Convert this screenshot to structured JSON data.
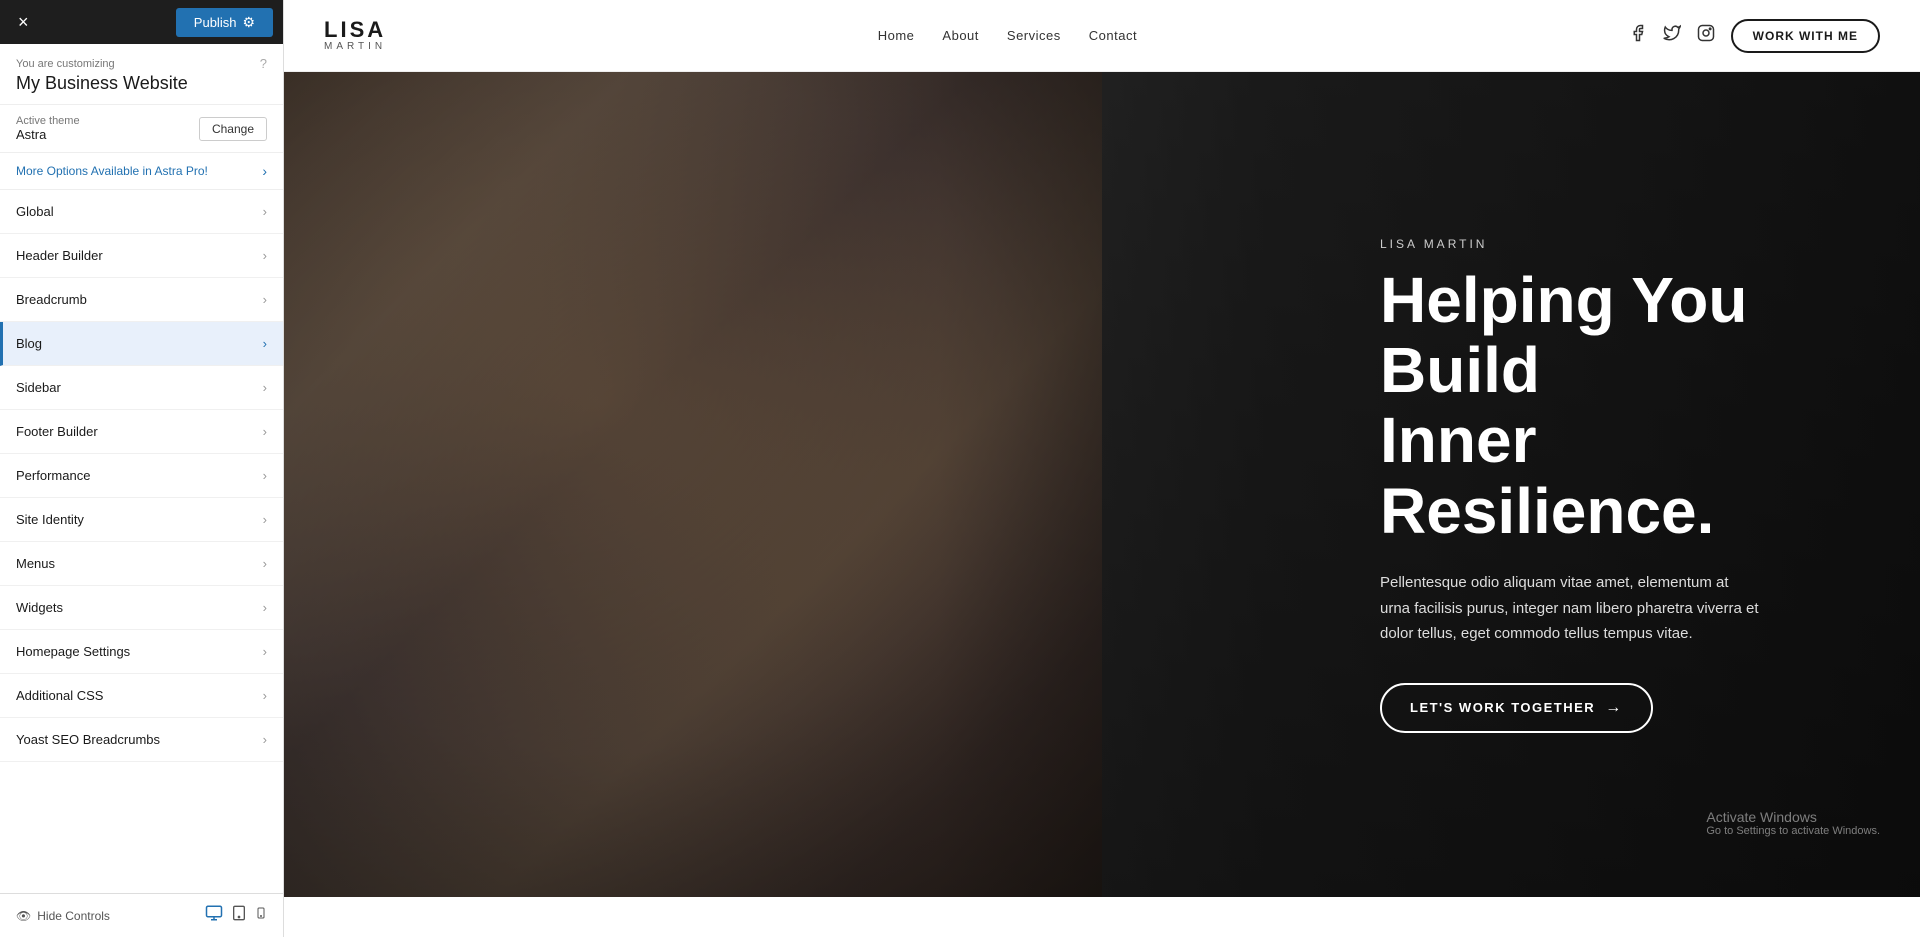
{
  "sidebar": {
    "topbar": {
      "close_label": "×",
      "publish_label": "Publish",
      "gear_icon": "⚙"
    },
    "customizing": {
      "label": "You are customizing",
      "help_icon": "?",
      "title": "My Business Website"
    },
    "active_theme": {
      "label": "Active theme",
      "name": "Astra",
      "change_label": "Change"
    },
    "astra_banner": {
      "text": "More Options Available in Astra Pro!"
    },
    "nav_items": [
      {
        "label": "Global",
        "active": false
      },
      {
        "label": "Header Builder",
        "active": false
      },
      {
        "label": "Breadcrumb",
        "active": false
      },
      {
        "label": "Blog",
        "active": true
      },
      {
        "label": "Sidebar",
        "active": false
      },
      {
        "label": "Footer Builder",
        "active": false
      },
      {
        "label": "Performance",
        "active": false
      },
      {
        "label": "Site Identity",
        "active": false
      },
      {
        "label": "Menus",
        "active": false
      },
      {
        "label": "Widgets",
        "active": false
      },
      {
        "label": "Homepage Settings",
        "active": false
      },
      {
        "label": "Additional CSS",
        "active": false
      },
      {
        "label": "Yoast SEO Breadcrumbs",
        "active": false
      }
    ],
    "bottom": {
      "hide_controls_label": "Hide Controls",
      "desktop_icon": "🖥",
      "tablet_icon": "📋",
      "mobile_icon": "📱"
    }
  },
  "website": {
    "header": {
      "logo_name": "LISA",
      "logo_sub": "MARTIN",
      "nav": [
        {
          "label": "Home"
        },
        {
          "label": "About"
        },
        {
          "label": "Services"
        },
        {
          "label": "Contact"
        }
      ],
      "social": {
        "facebook": "f",
        "twitter": "𝕏",
        "instagram": "◻"
      },
      "cta_label": "WORK WITH ME"
    },
    "hero": {
      "name_tag": "LISA MARTIN",
      "heading_line1": "Helping You Build",
      "heading_line2": "Inner Resilience.",
      "paragraph": "Pellentesque odio aliquam vitae amet, elementum at urna facilisis purus, integer nam libero pharetra viverra et dolor tellus, eget commodo tellus tempus vitae.",
      "cta_label": "LET'S WORK TOGETHER",
      "cta_arrow": "→"
    },
    "watermark": {
      "title": "Activate Windows",
      "subtitle": "Go to Settings to activate Windows."
    }
  }
}
